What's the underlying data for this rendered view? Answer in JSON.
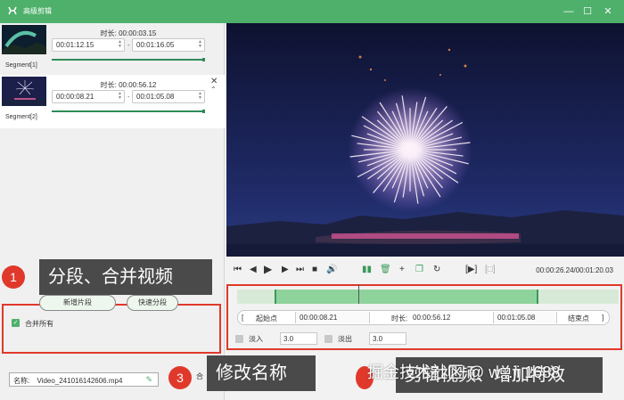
{
  "window": {
    "title": "高级剪辑"
  },
  "segments": [
    {
      "label": "Segment[1]",
      "duration": "时长: 00:00:03.15",
      "start": "00:01:12.15",
      "end": "00:01:16.05",
      "progress": 1.0
    },
    {
      "label": "Segment[2]",
      "duration": "时长: 00:00:56.12",
      "start": "00:00:08.21",
      "end": "00:01:05.08",
      "progress": 1.0
    }
  ],
  "left_actions": {
    "new_segment": "新增片段",
    "quick_split": "快速分段",
    "merge_all": "合并所有",
    "merge_all_checked": true
  },
  "filename": {
    "label": "名称:",
    "value": "Video_241016142606.mp4"
  },
  "annotations": {
    "a1": {
      "num": "1",
      "text": "分段、合并视频"
    },
    "a2": {
      "num": "2"
    },
    "a3": {
      "num": "3",
      "text": "修改名称"
    },
    "a4": {
      "text": "剪辑视频、增加特效"
    },
    "partial_left": "合"
  },
  "player": {
    "time": "00:00:26.24/00:01:20.03"
  },
  "trim": {
    "start_label": "起始点",
    "start_value": "00:00:08.21",
    "duration_label": "时长:",
    "duration_value": "00:00:56.12",
    "end_value": "00:01:05.08",
    "end_label": "结束点",
    "bracket_open": "[",
    "bracket_close": "]"
  },
  "fade": {
    "in_label": "淡入",
    "in_value": "3.0",
    "out_label": "淡出",
    "out_value": "3.0"
  },
  "watermark": "掘金技术社区 @ w...ji 1688",
  "colors": {
    "brand": "#4fb06b",
    "annotation_red": "#e0392b",
    "annotation_bg": "#4a4a4a"
  }
}
